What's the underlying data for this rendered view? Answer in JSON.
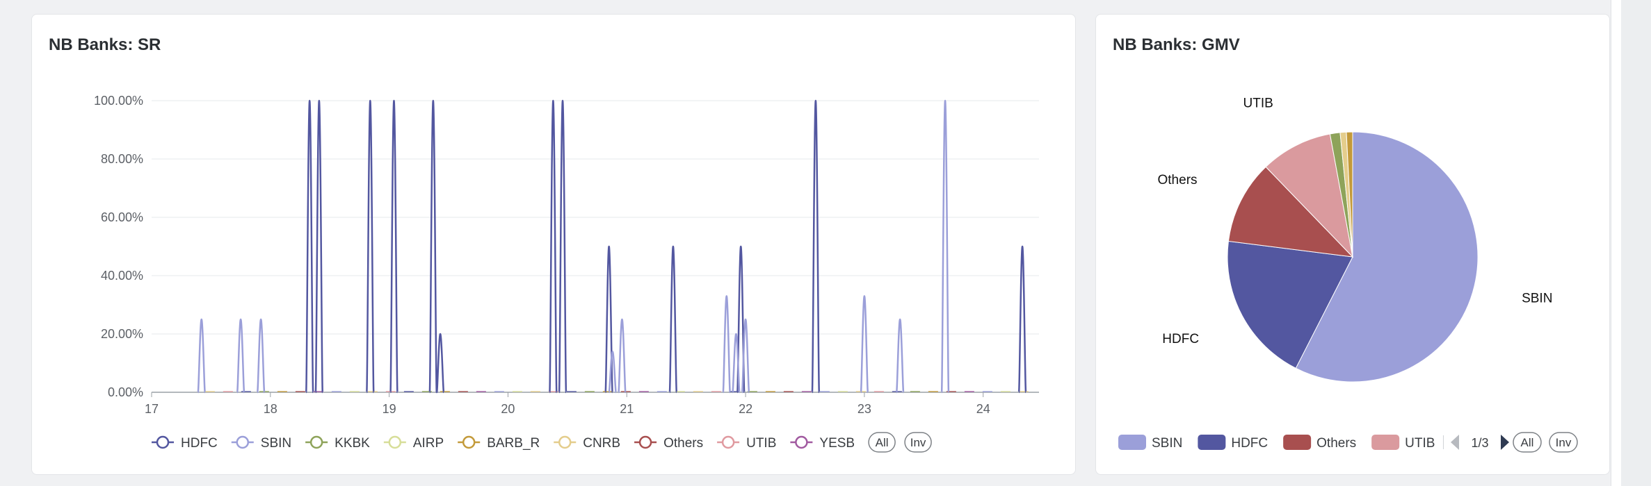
{
  "panels": {
    "sr_title": "NB Banks: SR",
    "gmv_title": "NB Banks: GMV"
  },
  "chart_data": [
    {
      "type": "line",
      "title": "NB Banks: SR",
      "x_ticks": [
        "17",
        "18",
        "19",
        "20",
        "21",
        "22",
        "23",
        "24"
      ],
      "y_ticks": [
        "0.00%",
        "20.00%",
        "40.00%",
        "60.00%",
        "80.00%",
        "100.00%"
      ],
      "xlim": [
        17,
        24.47
      ],
      "ylim": [
        0,
        100
      ],
      "grid": true,
      "legend": "bottom",
      "legend_controls": [
        "All",
        "Inv"
      ],
      "series": [
        {
          "name": "HDFC",
          "color": "#5357a0",
          "spikes": [
            [
              18.33,
              100
            ],
            [
              18.41,
              100
            ],
            [
              18.84,
              100
            ],
            [
              19.04,
              100
            ],
            [
              19.37,
              100
            ],
            [
              19.43,
              20
            ],
            [
              20.38,
              100
            ],
            [
              20.46,
              100
            ],
            [
              20.85,
              50
            ],
            [
              21.39,
              50
            ],
            [
              21.96,
              50
            ],
            [
              22.59,
              100
            ],
            [
              24.33,
              50
            ]
          ]
        },
        {
          "name": "SBIN",
          "color": "#9b9fd9",
          "spikes": [
            [
              17.42,
              25
            ],
            [
              17.75,
              25
            ],
            [
              17.92,
              25
            ],
            [
              20.88,
              14
            ],
            [
              20.96,
              25
            ],
            [
              21.84,
              33
            ],
            [
              21.92,
              20
            ],
            [
              22.0,
              25
            ],
            [
              23.0,
              33
            ],
            [
              23.3,
              25
            ],
            [
              23.68,
              100
            ]
          ]
        },
        {
          "name": "KKBK",
          "color": "#8ea35a",
          "spikes": []
        },
        {
          "name": "AIRP",
          "color": "#d7de99",
          "spikes": []
        },
        {
          "name": "BARB_R",
          "color": "#c39a3a",
          "spikes": []
        },
        {
          "name": "CNRB",
          "color": "#e4cd8c",
          "spikes": []
        },
        {
          "name": "Others",
          "color": "#a84f4f",
          "spikes": []
        },
        {
          "name": "UTIB",
          "color": "#e09aa0",
          "spikes": []
        },
        {
          "name": "YESB",
          "color": "#a15aa0",
          "spikes": []
        }
      ]
    },
    {
      "type": "pie",
      "title": "NB Banks: GMV",
      "slices": [
        {
          "name": "SBIN",
          "value": 57.5,
          "color": "#9b9fd9",
          "label": "SBIN"
        },
        {
          "name": "HDFC",
          "value": 19.5,
          "color": "#5357a0",
          "label": "HDFC"
        },
        {
          "name": "Others",
          "value": 10.8,
          "color": "#a84f4f",
          "label": "Others"
        },
        {
          "name": "UTIB",
          "value": 9.3,
          "color": "#da9a9e",
          "label": "UTIB"
        },
        {
          "name": "KKBK",
          "value": 1.3,
          "color": "#8ea35a",
          "label": ""
        },
        {
          "name": "CNRB",
          "value": 0.8,
          "color": "#e4cd8c",
          "label": ""
        },
        {
          "name": "BARB_R",
          "value": 0.8,
          "color": "#c39a3a",
          "label": ""
        }
      ],
      "legend_items": [
        "SBIN",
        "HDFC",
        "Others",
        "UTIB"
      ],
      "legend_page": "1/3",
      "legend_controls": [
        "All",
        "Inv"
      ]
    }
  ]
}
